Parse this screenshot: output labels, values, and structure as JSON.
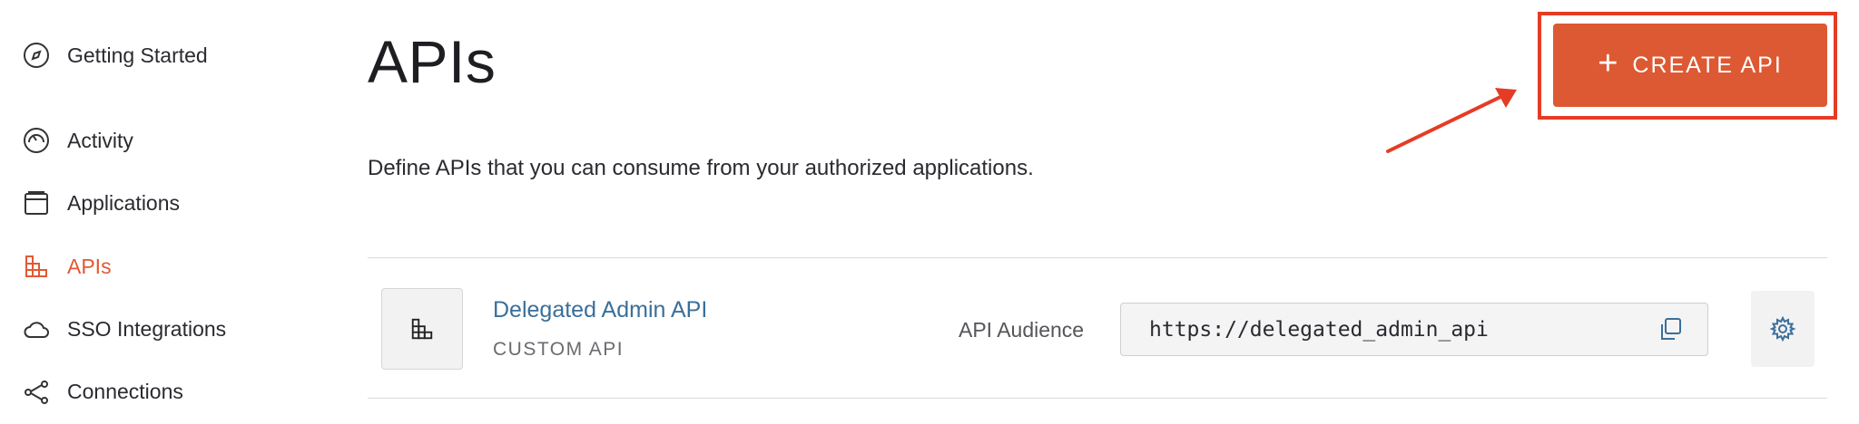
{
  "sidebar": {
    "items": [
      {
        "label": "Getting Started",
        "icon": "compass-icon"
      },
      {
        "label": "Activity",
        "icon": "gauge-icon"
      },
      {
        "label": "Applications",
        "icon": "window-icon"
      },
      {
        "label": "APIs",
        "icon": "api-blocks-icon",
        "active": true
      },
      {
        "label": "SSO Integrations",
        "icon": "cloud-icon"
      },
      {
        "label": "Connections",
        "icon": "share-nodes-icon"
      }
    ]
  },
  "page": {
    "title": "APIs",
    "description": "Define APIs that you can consume from your authorized applications."
  },
  "create_button": {
    "label": "CREATE API",
    "icon": "plus-icon"
  },
  "apis": [
    {
      "name": "Delegated Admin API",
      "type": "CUSTOM API",
      "audience_label": "API Audience",
      "audience": "https://delegated_admin_api"
    }
  ],
  "colors": {
    "accent": "#dc5933",
    "highlight_box": "#e53c25",
    "link": "#3a6f9a"
  }
}
